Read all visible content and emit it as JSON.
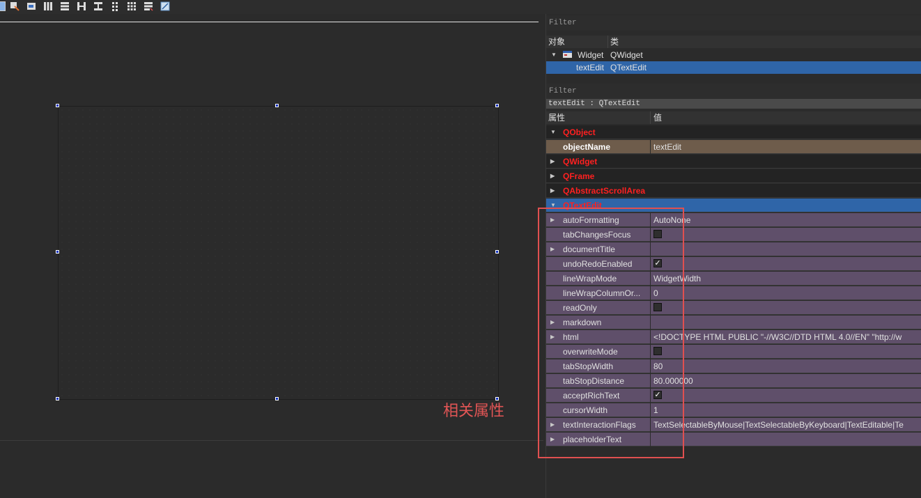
{
  "toolbar": {
    "icons": [
      "edit-widgets-icon",
      "edit-signals-icon",
      "edit-buddies-icon",
      "edit-tab-order-icon",
      "layout-horizontal-icon",
      "layout-vertical-icon",
      "layout-h-splitter-icon",
      "layout-v-splitter-icon",
      "layout-form-icon",
      "layout-grid-icon",
      "break-layout-icon",
      "adjust-size-icon"
    ]
  },
  "object_inspector": {
    "filter_placeholder": "Filter",
    "col_object": "对象",
    "col_class": "类",
    "rows": [
      {
        "name": "Widget",
        "cls": "QWidget"
      },
      {
        "name": "textEdit",
        "cls": "QTextEdit"
      }
    ]
  },
  "property_editor": {
    "filter_placeholder": "Filter",
    "crumb": "textEdit : QTextEdit",
    "col_property": "属性",
    "col_value": "值",
    "cat_qobject": "QObject",
    "objectName_label": "objectName",
    "objectName_value": "textEdit",
    "cat_qwidget": "QWidget",
    "cat_qframe": "QFrame",
    "cat_qabstractscrollarea": "QAbstractScrollArea",
    "cat_qtextedit": "QTextEdit",
    "props": [
      {
        "name": "autoFormatting",
        "value": "AutoNone"
      },
      {
        "name": "tabChangesFocus",
        "value": ""
      },
      {
        "name": "documentTitle",
        "value": ""
      },
      {
        "name": "undoRedoEnabled",
        "value": "✓"
      },
      {
        "name": "lineWrapMode",
        "value": "WidgetWidth"
      },
      {
        "name": "lineWrapColumnOr...",
        "value": "0"
      },
      {
        "name": "readOnly",
        "value": ""
      },
      {
        "name": "markdown",
        "value": ""
      },
      {
        "name": "html",
        "value": "<!DOCTYPE HTML PUBLIC \"-//W3C//DTD HTML 4.0//EN\" \"http://w"
      },
      {
        "name": "overwriteMode",
        "value": ""
      },
      {
        "name": "tabStopWidth",
        "value": "80"
      },
      {
        "name": "tabStopDistance",
        "value": "80.000000"
      },
      {
        "name": "acceptRichText",
        "value": "✓"
      },
      {
        "name": "cursorWidth",
        "value": "1"
      },
      {
        "name": "textInteractionFlags",
        "value": "TextSelectableByMouse|TextSelectableByKeyboard|TextEditable|Te"
      },
      {
        "name": "placeholderText",
        "value": ""
      }
    ]
  },
  "annotation": {
    "text": "相关属性",
    "color": "#e25555"
  }
}
